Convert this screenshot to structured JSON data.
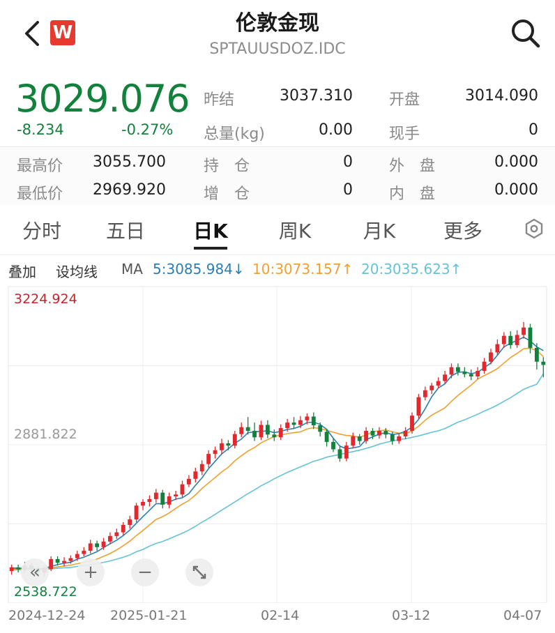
{
  "header": {
    "title": "伦敦金现",
    "symbol": "SPTAUUSDOZ.IDC",
    "logo_letter": "W"
  },
  "quote": {
    "price": "3029.076",
    "change": "-8.234",
    "change_pct": "-0.27%",
    "rows": [
      {
        "l1": "昨结",
        "v1": "3037.310",
        "l2": "开盘",
        "v2": "3014.090"
      },
      {
        "l1": "总量(kg)",
        "v1": "0.00",
        "l2": "现手",
        "v2": "0"
      },
      {
        "l0": "最高价",
        "v0": "3055.700",
        "l1": "持　仓",
        "v1": "0",
        "l2": "外　盘",
        "v2": "0.000"
      },
      {
        "l0": "最低价",
        "v0": "2969.920",
        "l1": "增　仓",
        "v1": "0",
        "l2": "内　盘",
        "v2": "0.000"
      }
    ]
  },
  "tabs": [
    "分时",
    "五日",
    "日K",
    "周K",
    "月K",
    "更多"
  ],
  "active_tab": "日K",
  "ma_bar": {
    "overlay": "叠加",
    "set_ma": "设均线",
    "ma": "MA",
    "ma5": "5:3085.984↓",
    "ma10": "10:3073.157↑",
    "ma20": "20:3035.623↑"
  },
  "colors": {
    "up": "#e0282d",
    "down": "#12813b",
    "ma5": "#2b7fb0",
    "ma10": "#f0a030",
    "ma20": "#65c3d3"
  },
  "chart_data": {
    "type": "candlestick",
    "y_labels": {
      "max": "3224.924",
      "mid": "2881.822",
      "min": "2538.722"
    },
    "ylim": [
      2538.722,
      3224.924
    ],
    "x_labels": [
      "2024-12-24",
      "2025-01-21",
      "02-14",
      "03-12",
      "04-07"
    ],
    "candles": [
      [
        2608,
        2616,
        2622,
        2600
      ],
      [
        2616,
        2612,
        2622,
        2605
      ],
      [
        2612,
        2620,
        2628,
        2606
      ],
      [
        2620,
        2614,
        2626,
        2608
      ],
      [
        2614,
        2605,
        2618,
        2598
      ],
      [
        2605,
        2612,
        2618,
        2598
      ],
      [
        2612,
        2634,
        2640,
        2608
      ],
      [
        2634,
        2626,
        2640,
        2620
      ],
      [
        2626,
        2630,
        2638,
        2618
      ],
      [
        2630,
        2636,
        2642,
        2624
      ],
      [
        2636,
        2645,
        2652,
        2630
      ],
      [
        2645,
        2652,
        2660,
        2640
      ],
      [
        2652,
        2668,
        2676,
        2646
      ],
      [
        2668,
        2660,
        2674,
        2652
      ],
      [
        2660,
        2672,
        2680,
        2654
      ],
      [
        2672,
        2684,
        2692,
        2666
      ],
      [
        2684,
        2692,
        2700,
        2678
      ],
      [
        2692,
        2708,
        2714,
        2686
      ],
      [
        2708,
        2720,
        2728,
        2700
      ],
      [
        2720,
        2750,
        2756,
        2714
      ],
      [
        2750,
        2758,
        2764,
        2740
      ],
      [
        2758,
        2764,
        2772,
        2748
      ],
      [
        2764,
        2778,
        2786,
        2756
      ],
      [
        2778,
        2752,
        2784,
        2744
      ],
      [
        2752,
        2770,
        2778,
        2744
      ],
      [
        2770,
        2774,
        2782,
        2762
      ],
      [
        2774,
        2796,
        2804,
        2768
      ],
      [
        2796,
        2808,
        2816,
        2790
      ],
      [
        2808,
        2824,
        2832,
        2800
      ],
      [
        2824,
        2840,
        2848,
        2816
      ],
      [
        2840,
        2862,
        2870,
        2832
      ],
      [
        2862,
        2870,
        2878,
        2852
      ],
      [
        2870,
        2885,
        2895,
        2862
      ],
      [
        2885,
        2880,
        2892,
        2870
      ],
      [
        2880,
        2905,
        2912,
        2874
      ],
      [
        2905,
        2920,
        2930,
        2898
      ],
      [
        2920,
        2912,
        2942,
        2904
      ],
      [
        2912,
        2898,
        2930,
        2890
      ],
      [
        2898,
        2925,
        2934,
        2892
      ],
      [
        2925,
        2904,
        2935,
        2896
      ],
      [
        2904,
        2898,
        2915,
        2890
      ],
      [
        2898,
        2918,
        2926,
        2892
      ],
      [
        2918,
        2930,
        2938,
        2910
      ],
      [
        2930,
        2925,
        2942,
        2918
      ],
      [
        2925,
        2935,
        2944,
        2918
      ],
      [
        2935,
        2943,
        2950,
        2926
      ],
      [
        2943,
        2924,
        2952,
        2916
      ],
      [
        2924,
        2910,
        2930,
        2900
      ],
      [
        2910,
        2888,
        2916,
        2878
      ],
      [
        2888,
        2872,
        2896,
        2866
      ],
      [
        2872,
        2852,
        2878,
        2845
      ],
      [
        2852,
        2880,
        2888,
        2846
      ],
      [
        2880,
        2900,
        2908,
        2874
      ],
      [
        2900,
        2890,
        2905,
        2882
      ],
      [
        2890,
        2912,
        2920,
        2884
      ],
      [
        2912,
        2902,
        2918,
        2894
      ],
      [
        2902,
        2912,
        2920,
        2895
      ],
      [
        2912,
        2904,
        2918,
        2896
      ],
      [
        2904,
        2890,
        2910,
        2882
      ],
      [
        2890,
        2900,
        2906,
        2884
      ],
      [
        2900,
        2912,
        2920,
        2894
      ],
      [
        2912,
        2945,
        2952,
        2906
      ],
      [
        2945,
        2985,
        2992,
        2938
      ],
      [
        2985,
        3000,
        3008,
        2978
      ],
      [
        3000,
        3010,
        3016,
        2992
      ],
      [
        3010,
        3020,
        3028,
        3004
      ],
      [
        3020,
        3034,
        3042,
        3014
      ],
      [
        3034,
        3050,
        3058,
        3026
      ],
      [
        3050,
        3040,
        3058,
        3032
      ],
      [
        3040,
        3035,
        3050,
        3028
      ],
      [
        3035,
        3030,
        3045,
        3022
      ],
      [
        3030,
        3042,
        3050,
        3024
      ],
      [
        3042,
        3062,
        3070,
        3036
      ],
      [
        3062,
        3082,
        3090,
        3056
      ],
      [
        3082,
        3100,
        3110,
        3076
      ],
      [
        3100,
        3118,
        3126,
        3092
      ],
      [
        3118,
        3098,
        3128,
        3090
      ],
      [
        3098,
        3120,
        3130,
        3092
      ],
      [
        3120,
        3136,
        3148,
        3112
      ],
      [
        3136,
        3092,
        3144,
        3080
      ],
      [
        3092,
        3062,
        3102,
        3045
      ],
      [
        3062,
        3055,
        3072,
        3028
      ]
    ],
    "ma5": [
      2615,
      2614,
      2614,
      2614,
      2613,
      2614,
      2618,
      2622,
      2625,
      2627,
      2634,
      2638,
      2644,
      2650,
      2659,
      2667,
      2675,
      2685,
      2697,
      2712,
      2726,
      2740,
      2754,
      2754,
      2758,
      2764,
      2767,
      2776,
      2794,
      2810,
      2830,
      2846,
      2862,
      2873,
      2885,
      2894,
      2908,
      2910,
      2911,
      2912,
      2908,
      2911,
      2915,
      2917,
      2922,
      2930,
      2931,
      2926,
      2915,
      2896,
      2879,
      2873,
      2875,
      2878,
      2893,
      2899,
      2905,
      2908,
      2904,
      2906,
      2911,
      2920,
      2937,
      2960,
      2986,
      3005,
      3014,
      3031,
      3039,
      3040,
      3036,
      3039,
      3049,
      3059,
      3076,
      3094,
      3102,
      3108,
      3115,
      3107,
      3094,
      3086
    ],
    "ma10": [
      2612,
      2613,
      2613,
      2613,
      2613,
      2613,
      2615,
      2617,
      2619,
      2621,
      2624,
      2627,
      2630,
      2634,
      2640,
      2646,
      2654,
      2663,
      2673,
      2685,
      2696,
      2708,
      2720,
      2726,
      2734,
      2744,
      2753,
      2761,
      2773,
      2787,
      2799,
      2811,
      2823,
      2833,
      2847,
      2858,
      2868,
      2876,
      2886,
      2893,
      2900,
      2903,
      2906,
      2908,
      2910,
      2916,
      2919,
      2917,
      2913,
      2909,
      2905,
      2902,
      2901,
      2898,
      2903,
      2910,
      2912,
      2914,
      2910,
      2907,
      2906,
      2912,
      2922,
      2935,
      2946,
      2954,
      2962,
      2976,
      2989,
      3000,
      3011,
      3024,
      3032,
      3039,
      3047,
      3059,
      3071,
      3080,
      3090,
      3091,
      3086,
      3073
    ],
    "ma20": [
      2610,
      2611,
      2611,
      2612,
      2612,
      2612,
      2613,
      2614,
      2615,
      2616,
      2618,
      2620,
      2622,
      2624,
      2627,
      2630,
      2634,
      2638,
      2643,
      2650,
      2655,
      2662,
      2668,
      2672,
      2678,
      2684,
      2690,
      2697,
      2705,
      2714,
      2722,
      2731,
      2740,
      2749,
      2758,
      2767,
      2776,
      2784,
      2793,
      2800,
      2808,
      2815,
      2822,
      2828,
      2834,
      2840,
      2846,
      2850,
      2855,
      2858,
      2861,
      2864,
      2867,
      2870,
      2874,
      2878,
      2883,
      2887,
      2890,
      2893,
      2895,
      2898,
      2901,
      2905,
      2909,
      2912,
      2917,
      2924,
      2931,
      2936,
      2942,
      2948,
      2955,
      2961,
      2968,
      2976,
      2984,
      2993,
      3002,
      3008,
      3013,
      3036
    ]
  }
}
